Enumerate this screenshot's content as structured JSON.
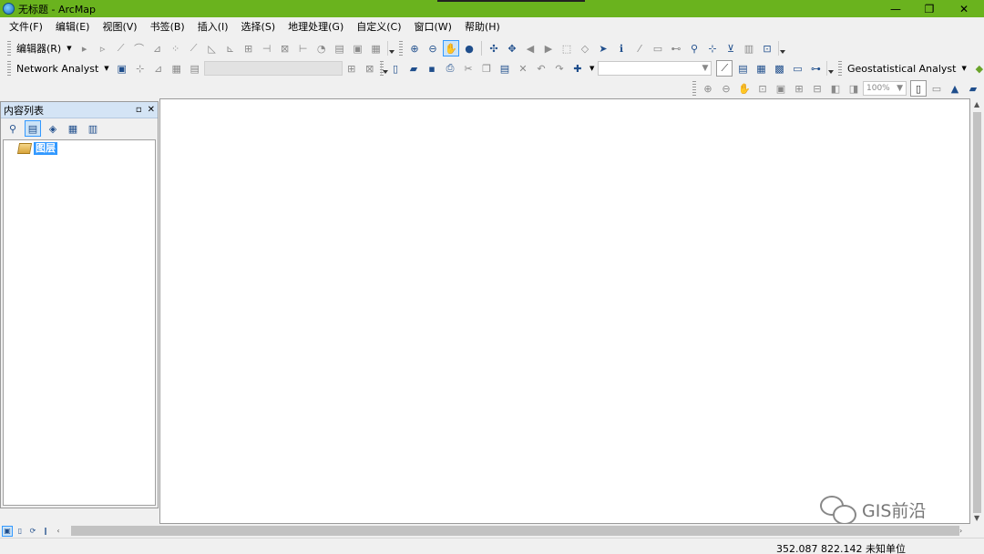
{
  "window": {
    "title": "无标题 - ArcMap",
    "minimize_glyph": "—",
    "restore_glyph": "❐",
    "close_glyph": "✕"
  },
  "menu": [
    "文件(F)",
    "编辑(E)",
    "视图(V)",
    "书签(B)",
    "插入(I)",
    "选择(S)",
    "地理处理(G)",
    "自定义(C)",
    "窗口(W)",
    "帮助(H)"
  ],
  "toolbars": {
    "editor_label": "编辑器(R)",
    "network_analyst_label": "Network Analyst",
    "geostatistical_label": "Geostatistical Analyst",
    "zoom_level": "100%"
  },
  "toc": {
    "title": "内容列表",
    "layer_label": "图层"
  },
  "watermark": "GIS前沿",
  "status": {
    "coordinates": "352.087  822.142 未知单位"
  },
  "colors": {
    "titlebar": "#6ab31e",
    "selection": "#3399ff"
  }
}
